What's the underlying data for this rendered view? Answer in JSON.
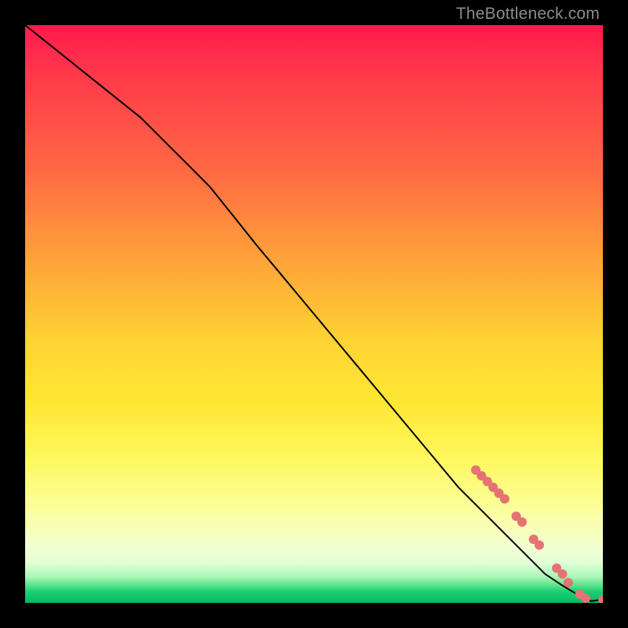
{
  "watermark": "TheBottleneck.com",
  "chart_data": {
    "type": "line",
    "title": "",
    "xlabel": "",
    "ylabel": "",
    "xlim": [
      0,
      100
    ],
    "ylim": [
      0,
      100
    ],
    "grid": false,
    "legend": false,
    "series": [
      {
        "name": "curve",
        "x": [
          0,
          5,
          10,
          15,
          20,
          24,
          28,
          32,
          36,
          40,
          45,
          50,
          55,
          60,
          65,
          70,
          75,
          80,
          85,
          90,
          93,
          95,
          97,
          98,
          100
        ],
        "y": [
          100,
          96,
          92,
          88,
          84,
          80,
          76,
          72,
          67,
          62,
          56,
          50,
          44,
          38,
          32,
          26,
          20,
          15,
          10,
          5,
          3,
          1.8,
          0.8,
          0.3,
          0.6
        ],
        "stroke": "#000000",
        "stroke_width": 2
      }
    ],
    "markers": {
      "name": "highlight-points",
      "color": "#e57373",
      "radius": 6,
      "points": [
        {
          "x": 78,
          "y": 23
        },
        {
          "x": 79,
          "y": 22
        },
        {
          "x": 80,
          "y": 21
        },
        {
          "x": 81,
          "y": 20
        },
        {
          "x": 82,
          "y": 19
        },
        {
          "x": 83,
          "y": 18
        },
        {
          "x": 85,
          "y": 15
        },
        {
          "x": 86,
          "y": 14
        },
        {
          "x": 88,
          "y": 11
        },
        {
          "x": 89,
          "y": 10
        },
        {
          "x": 92,
          "y": 6
        },
        {
          "x": 93,
          "y": 5
        },
        {
          "x": 94,
          "y": 3.5
        },
        {
          "x": 96,
          "y": 1.5
        },
        {
          "x": 97,
          "y": 0.8
        },
        {
          "x": 100,
          "y": 0.6
        }
      ]
    }
  }
}
